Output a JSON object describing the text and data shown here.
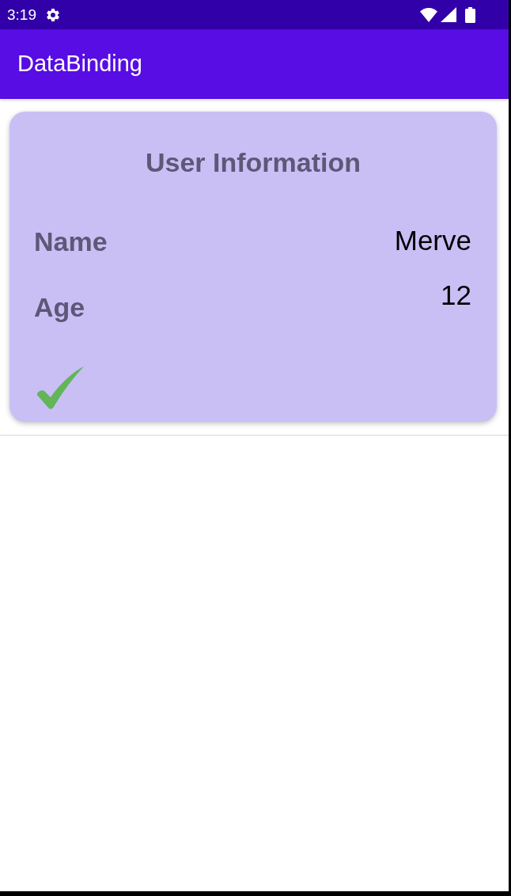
{
  "status_bar": {
    "time": "3:19"
  },
  "app_bar": {
    "title": "DataBinding"
  },
  "card": {
    "title": "User Information",
    "fields": [
      {
        "label": "Name",
        "value": "Merve"
      },
      {
        "label": "Age",
        "value": "12"
      }
    ],
    "checked": true
  }
}
